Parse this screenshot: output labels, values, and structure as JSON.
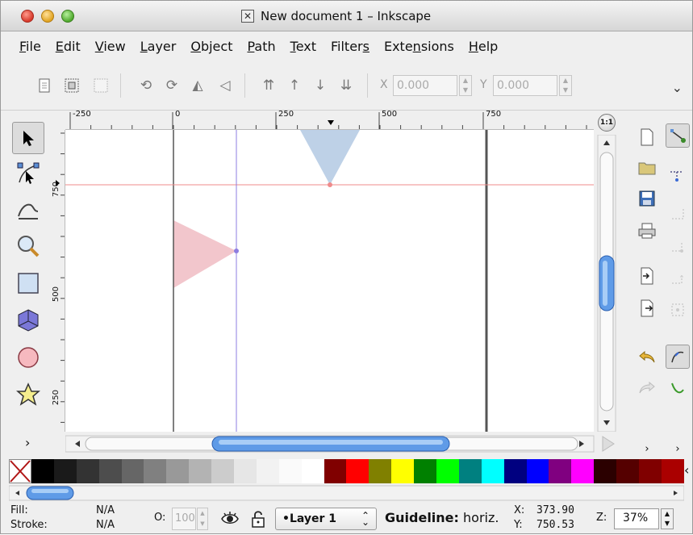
{
  "window": {
    "title": "New document 1 – Inkscape"
  },
  "menu": {
    "items": [
      {
        "label": "File",
        "u": "F",
        "rest": "ile"
      },
      {
        "label": "Edit",
        "u": "E",
        "rest": "dit"
      },
      {
        "label": "View",
        "u": "V",
        "rest": "iew"
      },
      {
        "label": "Layer",
        "u": "L",
        "rest": "ayer"
      },
      {
        "label": "Object",
        "u": "O",
        "rest": "bject"
      },
      {
        "label": "Path",
        "u": "P",
        "rest": "ath"
      },
      {
        "label": "Text",
        "u": "T",
        "rest": "ext"
      },
      {
        "label": "Filters",
        "pre": "Filter",
        "u": "s",
        "rest": ""
      },
      {
        "label": "Extensions",
        "pre": "Exte",
        "u": "n",
        "rest": "sions"
      },
      {
        "label": "Help",
        "u": "H",
        "rest": "elp"
      }
    ]
  },
  "toolbar": {
    "x_label": "X",
    "x_value": "0.000",
    "y_label": "Y",
    "y_value": "0.000"
  },
  "ruler": {
    "top_ticks": [
      "-250",
      "0",
      "250",
      "500",
      "750"
    ],
    "left_ticks": [
      "750",
      "500",
      "250"
    ]
  },
  "canvas": {
    "guide_horizontal_color": "#ef8b8b",
    "guide_vertical_color": "#8d7ee0",
    "triangle_top_color": "#b3c9e3",
    "triangle_left_color": "#f2c6cc"
  },
  "palette": {
    "colors": [
      "#000000",
      "#1a1a1a",
      "#333333",
      "#4d4d4d",
      "#666666",
      "#808080",
      "#999999",
      "#b3b3b3",
      "#cccccc",
      "#e6e6e6",
      "#f2f2f2",
      "#fafafa",
      "#ffffff",
      "#800000",
      "#ff0000",
      "#808000",
      "#ffff00",
      "#008000",
      "#00ff00",
      "#008080",
      "#00ffff",
      "#000080",
      "#0000ff",
      "#800080",
      "#ff00ff",
      "#2b0000",
      "#550000",
      "#800000",
      "#aa0000"
    ]
  },
  "status": {
    "fill_label": "Fill:",
    "fill_value": "N/A",
    "stroke_label": "Stroke:",
    "stroke_value": "N/A",
    "opacity_label": "O:",
    "opacity_value": "100",
    "layer_label": "•Layer 1",
    "message_bold": "Guideline:",
    "message_rest": " horiz.",
    "x_label": "X:",
    "x_value": "373.90",
    "y_label": "Y:",
    "y_value": "750.53",
    "zoom_label": "Z:",
    "zoom_value": "37%"
  }
}
